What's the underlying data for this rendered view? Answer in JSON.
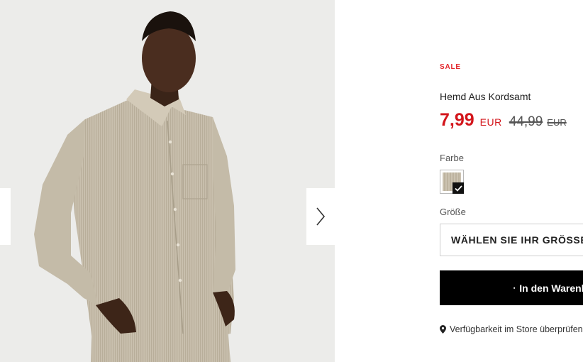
{
  "gallery": {
    "image_alt": "Model trägt beiges Hemd aus Kordsamt",
    "next_icon": "chevron-right-icon",
    "prev_icon": "chevron-left-icon"
  },
  "product": {
    "badge": "SALE",
    "title": "Hemd Aus Kordsamt",
    "price": {
      "current": "7,99",
      "current_currency": "EUR",
      "original": "44,99",
      "original_currency": "EUR"
    },
    "color": {
      "label": "Farbe",
      "selected_icon": "check-icon"
    },
    "size": {
      "label": "Größe",
      "placeholder": "WÄHLEN SIE IHR GRÖSSE"
    },
    "cart_button": {
      "icon": "shopping-bag-icon",
      "label": "In den Warenkorb"
    },
    "store_availability": {
      "icon": "map-pin-icon",
      "label": "Verfügbarkeit im Store überprüfen"
    }
  },
  "colors": {
    "sale_red": "#e3262b",
    "price_red": "#d3151b",
    "cart_black": "#000000",
    "gallery_bg": "#ececea"
  }
}
